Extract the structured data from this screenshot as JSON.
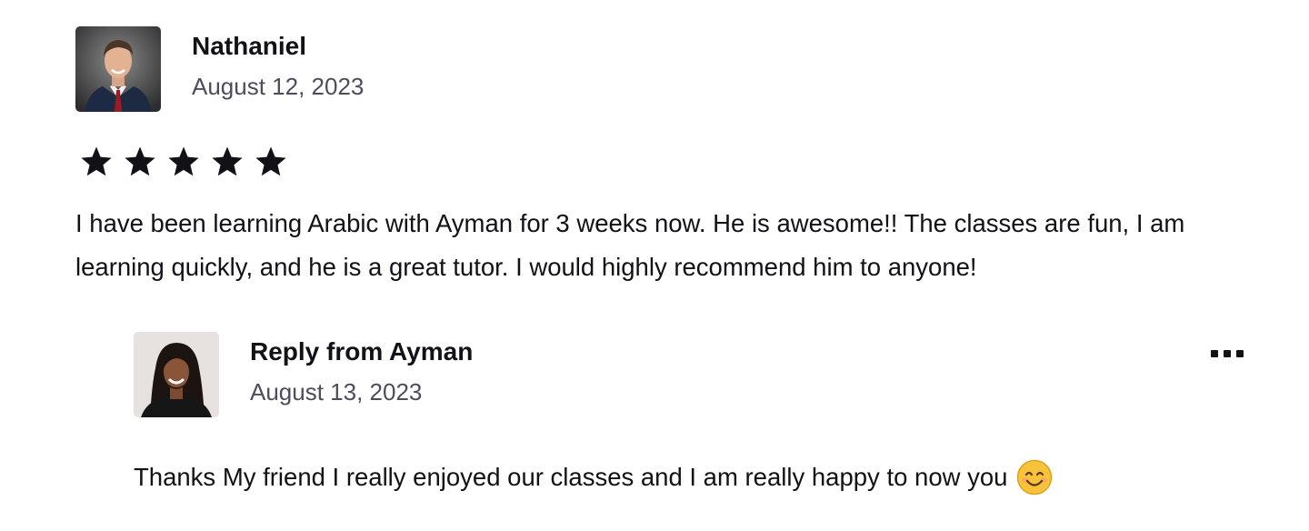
{
  "review": {
    "author": "Nathaniel",
    "date": "August 12, 2023",
    "rating": 5,
    "rating_max": 5,
    "text": "I have been learning Arabic with Ayman for 3 weeks now. He is awesome!! The classes are fun, I am learning quickly, and he is a great tutor. I would highly recommend him to anyone!"
  },
  "reply": {
    "title": "Reply from Ayman",
    "date": "August 13, 2023",
    "text": "Thanks My friend I really enjoyed our classes and I am really happy to now you",
    "emoji": "smiling-face-emoji",
    "menu_icon": "more-options-icon"
  },
  "colors": {
    "text_primary": "#121117",
    "text_secondary": "#4d4c5c",
    "star": "#121117",
    "emoji_face": "#f7c33a"
  }
}
